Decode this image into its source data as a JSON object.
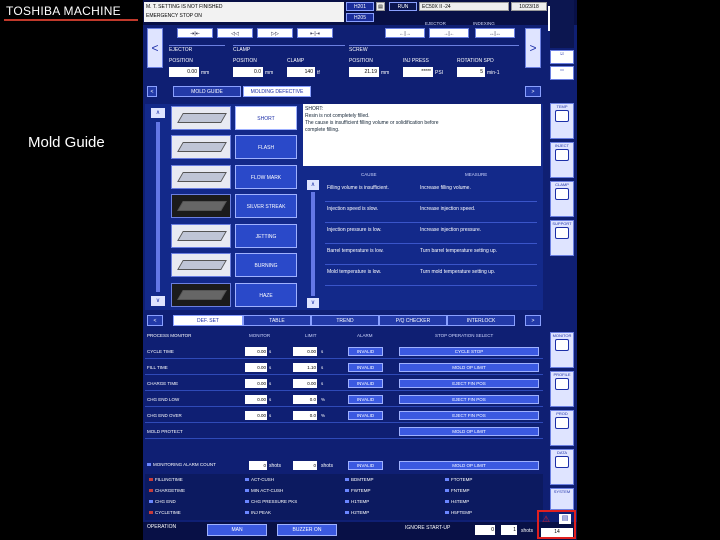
{
  "slide": {
    "title": "TOSHIBA MACHINE",
    "caption": "Mold Guide"
  },
  "top": {
    "warning1": "M. T. SETTING IS NOT FINISHED",
    "warning2": "EMERGENCY STOP ON",
    "chip1": "H201",
    "chip2": "H205",
    "run": "RUN",
    "model": "EC50X II -24",
    "date": "10/23/18",
    "time": "09:49",
    "logo": "V",
    "row_labels": [
      "EJECTOR",
      "INDEXING"
    ]
  },
  "params": {
    "groups": [
      "EJECTOR",
      "CLAMP",
      "SCREW"
    ],
    "items": [
      {
        "label": "POSITION",
        "value": "0.00",
        "unit": "mm"
      },
      {
        "label": "POSITION",
        "value": "0.0",
        "unit": "mm"
      },
      {
        "label": "CLAMP",
        "value": "140",
        "unit": "tf"
      },
      {
        "label": "POSITION",
        "value": "21.19",
        "unit": "mm"
      },
      {
        "label": "INJ PRESS",
        "value": "*****",
        "unit": "PSI"
      },
      {
        "label": "ROTATION SPD",
        "value": "5",
        "unit": "min-1"
      }
    ]
  },
  "tabs1": [
    "MOLD GUIDE",
    "MOLDING DEFECTIVE"
  ],
  "defects": [
    "SHORT",
    "FLASH",
    "FLOW MARK",
    "SILVER STREAK",
    "JETTING",
    "BURNING",
    "HAZE"
  ],
  "info": {
    "heading": "SHORT:",
    "lines": [
      "Resin is not completely filled.",
      "The cause is insufficient filling volume or solidification before",
      "complete filling."
    ]
  },
  "causes": {
    "headers": [
      "CAUSE",
      "MEASURE"
    ],
    "rows": [
      {
        "cause": "Filling volume is insufficient.",
        "measure": "Increase filling volume."
      },
      {
        "cause": "Injection speed is slow.",
        "measure": "Increase injection speed."
      },
      {
        "cause": "Injection pressure is low.",
        "measure": "Increase injection pressure."
      },
      {
        "cause": "Barrel temperature is low.",
        "measure": "Turn barrel temperature setting up."
      },
      {
        "cause": "Mold temperature is low.",
        "measure": "Turn mold temperature setting up."
      }
    ]
  },
  "tabs2": [
    "DEF. SET",
    "TABLE",
    "TREND",
    "P/Q CHECKER",
    "INTERLOCK"
  ],
  "monitor": {
    "headers": [
      "PROCESS MONITOR",
      "MONITOR",
      "LIMIT",
      "ALARM",
      "STOP OPERATION SELECT"
    ],
    "rows": [
      {
        "label": "CYCLE TIME",
        "mon": "0.00",
        "unit": "s",
        "limit": "0.00",
        "lunit": "s",
        "alarm": "INVALID",
        "stop": "CYCLE STOP"
      },
      {
        "label": "FILL TIME",
        "mon": "0.00",
        "unit": "s",
        "limit": "1.10",
        "lunit": "s",
        "alarm": "INVALID",
        "stop": "MOLD OP LIMIT"
      },
      {
        "label": "CHARGE TIME",
        "mon": "0.00",
        "unit": "s",
        "limit": "0.00",
        "lunit": "s",
        "alarm": "INVALID",
        "stop": "EJECT FIN POS"
      },
      {
        "label": "CHG END LOW",
        "mon": "0.00",
        "unit": "s",
        "limit": "0.0",
        "lunit": "%",
        "alarm": "INVALID",
        "stop": "EJECT FIN POS"
      },
      {
        "label": "CHG END OVER",
        "mon": "0.00",
        "unit": "s",
        "limit": "0.0",
        "lunit": "%",
        "alarm": "INVALID",
        "stop": "EJECT FIN POS"
      },
      {
        "label": "MOLD PROTECT",
        "mon": "",
        "unit": "",
        "limit": "",
        "lunit": "",
        "alarm": "",
        "stop": "MOLD OP LIMIT"
      }
    ]
  },
  "alarm_count": {
    "label": "MONITORING ALARM COUNT",
    "value": "0",
    "unit": "shots",
    "limit": "0",
    "lunit": "shots",
    "alarm": "INVALID",
    "stop": "MOLD OP LIMIT"
  },
  "alarm_items": [
    [
      "FILLINGTIME",
      "ACT-CUSH",
      "BDMTEMP",
      "FTOTEMP"
    ],
    [
      "CHARGETIME",
      "MIN ACT-CUSH",
      "FWTEMP",
      "FNTEMP"
    ],
    [
      "CHG END",
      "CHG PRESSURE PKS",
      "H1TEMP",
      "H4TEMP"
    ],
    [
      "CYCLETIME",
      "INJ PEAK",
      "H2TEMP",
      "H5FTEMP"
    ]
  ],
  "opbar": {
    "label": "OPERATION",
    "btn1": "MAN",
    "btn2": "BUZZER ON",
    "ignore": "IGNORE START-UP",
    "v1": "0",
    "v2": "1",
    "unit": "shots",
    "count": "14"
  },
  "sidebar": [
    "TEMP",
    "INJECT",
    "CLAMP",
    "SUPPORT",
    "MONITOR",
    "PROFILE",
    "PROD",
    "DATA",
    "SYSTEM"
  ]
}
